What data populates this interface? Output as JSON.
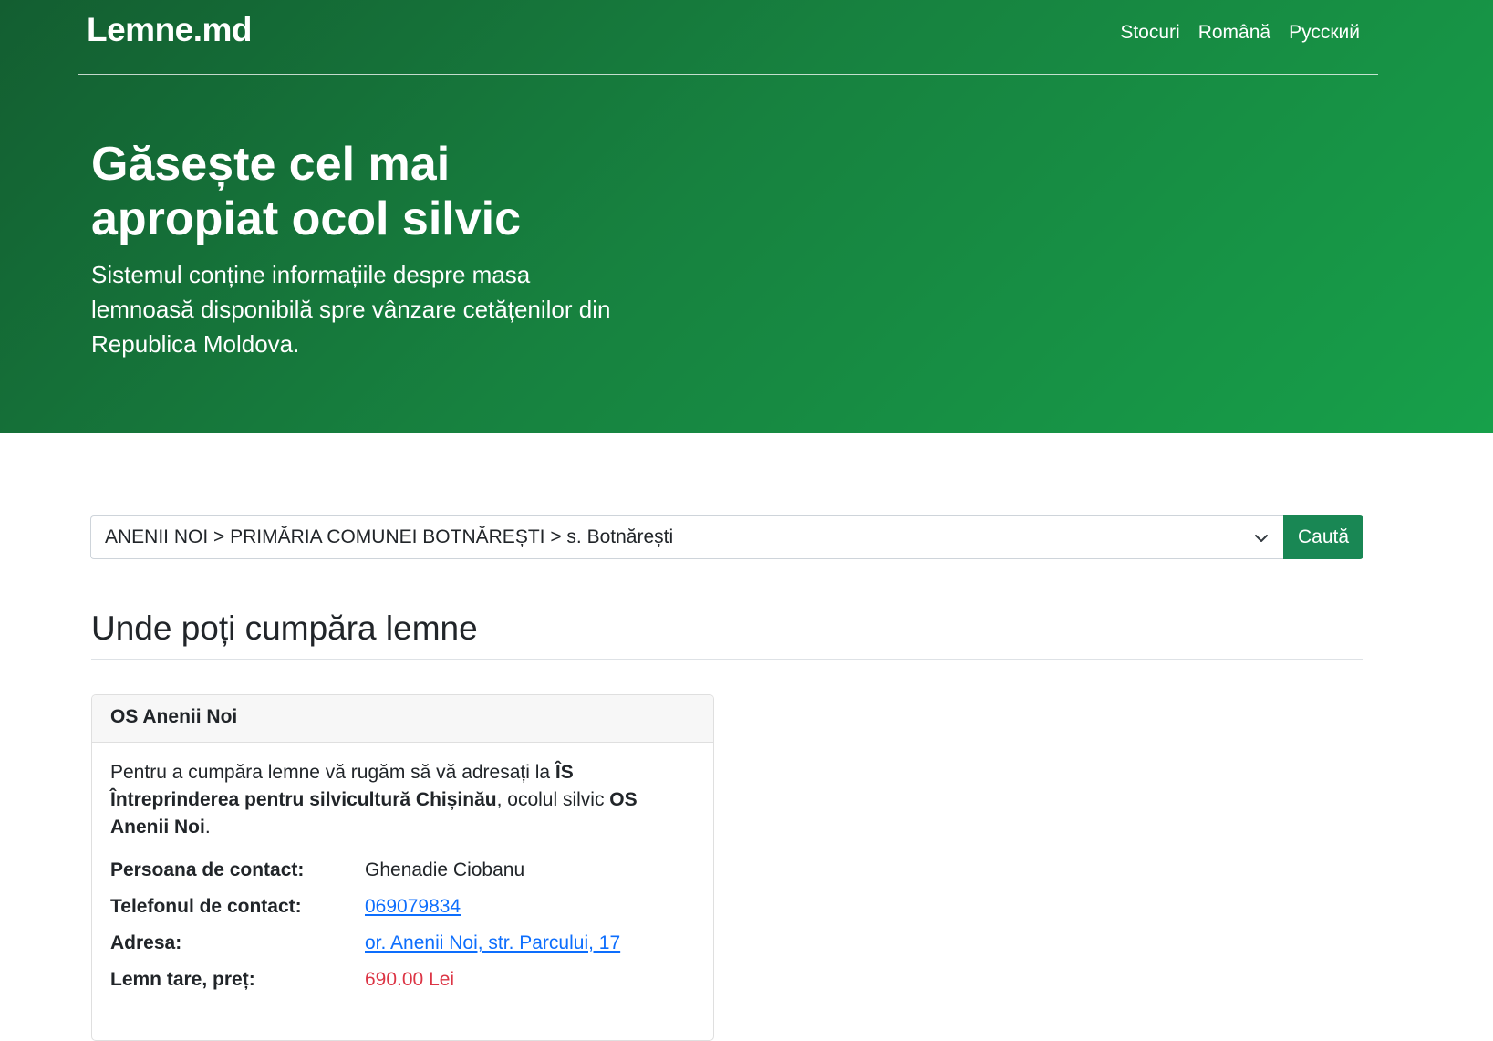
{
  "header": {
    "brand": "Lemne.md",
    "nav": [
      "Stocuri",
      "Română",
      "Русский"
    ]
  },
  "hero": {
    "title": "Găsește cel mai apropiat ocol silvic",
    "lead": "Sistemul conține informațiile despre masa lemnoasă disponibilă spre vânzare cetățenilor din Republica Moldova."
  },
  "search": {
    "selected": "ANENII NOI > PRIMĂRIA COMUNEI BOTNĂREȘTI > s. Botnărești",
    "button": "Caută"
  },
  "section": {
    "title": "Unde poți cumpăra lemne"
  },
  "card": {
    "header": "OS Anenii Noi",
    "intro_prefix": "Pentru a cumpăra lemne vă rugăm să vă adresați la ",
    "enterprise": "ÎS Întreprinderea pentru silvicultură Chișinău",
    "intro_middle": ", ocolul silvic ",
    "office": "OS Anenii Noi",
    "intro_suffix": ".",
    "contact_label": "Persoana de contact:",
    "contact_value": "Ghenadie Ciobanu",
    "phone_label": "Telefonul de contact:",
    "phone_value": "069079834",
    "address_label": "Adresa:",
    "address_value": "or. Anenii Noi, str. Parcului, 17",
    "price_label": "Lemn tare, preț:",
    "price_value": "690.00 Lei"
  },
  "colors": {
    "hero_start": "#135e31",
    "hero_end": "#17a04a",
    "button": "#198754",
    "link": "#0d6efd",
    "price": "#dc3545"
  }
}
